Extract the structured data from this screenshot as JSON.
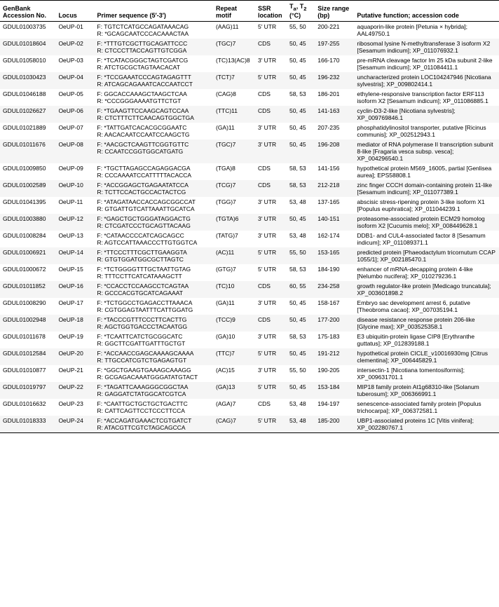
{
  "table": {
    "headers": [
      "GenBank\nAccession No.",
      "Locus",
      "Primer sequence (5′-3′)",
      "Repeat\nmotif",
      "SSR\nlocation",
      "Tₙ, Tₙ\n(°C)",
      "Size range\n(bp)",
      "Putative function; accession code"
    ],
    "rows": [
      {
        "accession": "GDUL01003735",
        "locus": "OeUP-01",
        "primer_f": "F: TGTCTCATGCCAGATAAACAG",
        "primer_r": "R: *GCAGCAATCCCACAAACTAA",
        "repeat": "(AAG)11",
        "ssr_loc": "5′ UTR",
        "temp": "55, 50",
        "size": "200-221",
        "function": "aquaporin-like protein [Petunia × hybrida]; AAL49750.1"
      },
      {
        "accession": "GDUL01018604",
        "locus": "OeUP-02",
        "primer_f": "F: *TTTGTCGCTTGCAGATTCCC",
        "primer_r": "R: CTCCCTTACCAGTTGTCGGA",
        "repeat": "(TGC)7",
        "ssr_loc": "CDS",
        "temp": "50, 45",
        "size": "197-255",
        "function": "ribosomal lysine N-methyltransferase 3 isoform X2 [Sesamum indicum]; XP_011076932.1"
      },
      {
        "accession": "GDUL01058010",
        "locus": "OeUP-03",
        "primer_f": "F: *TCATACGGGCTAGTCGATCG",
        "primer_r": "R: ATCTGCGCTAGTAACACAT",
        "repeat": "(TC)13(AC)8",
        "ssr_loc": "3′ UTR",
        "temp": "50, 45",
        "size": "166-170",
        "function": "pre-mRNA cleavage factor Im 25 kDa subunit 2-like [Sesamum indicum]; XP_011084411.1"
      },
      {
        "accession": "GDUL01030423",
        "locus": "OeUP-04",
        "primer_f": "F: *TCCGAAATCCCAGTAGAGTTT",
        "primer_r": "R: ATCAGCAGAAATCACCAATCCT",
        "repeat": "(TCT)7",
        "ssr_loc": "5′ UTR",
        "temp": "50, 45",
        "size": "196-232",
        "function": "uncharacterized protein LOC104247946 [Nicotiana sylvestris]; XP_009802414.1"
      },
      {
        "accession": "GDUL01046188",
        "locus": "OeUP-05",
        "primer_f": "F: GGCACCAAAGCTAAGCTCAA",
        "primer_r": "R: *CCCGGGAAAATGTTCTGT",
        "repeat": "(CAG)8",
        "ssr_loc": "CDS",
        "temp": "58, 53",
        "size": "186-201",
        "function": "ethylene-responsive transcription factor ERF113 isoform X2 [Sesamum indicum]; XP_011086885.1"
      },
      {
        "accession": "GDUL01026627",
        "locus": "OeUP-06",
        "primer_f": "F: *TGAAGTTCCAAGCAGTCCAA",
        "primer_r": "R: CTCTTTCTTCAACAGTGGCTGA",
        "repeat": "(TTC)11",
        "ssr_loc": "CDS",
        "temp": "50, 45",
        "size": "141-163",
        "function": "cyclin-D3-2-like [Nicotiana sylvestris]; XP_009769846.1"
      },
      {
        "accession": "GDUL01021889",
        "locus": "OeUP-07",
        "primer_f": "F: *TATTGATCACACGCGGAATC",
        "primer_r": "R: AACACAATCCAATCCAAGCTG",
        "repeat": "(GA)11",
        "ssr_loc": "3′ UTR",
        "temp": "50, 45",
        "size": "207-235",
        "function": "phosphatidylinositol transporter, putative [Ricinus communis]; XP_002512943.1"
      },
      {
        "accession": "GDUL01011676",
        "locus": "OeUP-08",
        "primer_f": "F: *AACGCTCAAGTTCGGTGTTC",
        "primer_r": "R: CCAATCCGGTGGCATGATG",
        "repeat": "(TGC)7",
        "ssr_loc": "3′ UTR",
        "temp": "50, 45",
        "size": "196-208",
        "function": "mediator of RNA polymerase II transcription subunit 8-like [Fragaria vesca subsp. vesca]; XP_004296540.1"
      },
      {
        "accession": "GDUL01009850",
        "locus": "OeUP-09",
        "primer_f": "F: *TGCTTAGAGCCAGAGGACGA",
        "primer_r": "R: CCCAAAATCCATTTTTACACCA",
        "repeat": "(TGA)8",
        "ssr_loc": "CDS",
        "temp": "58, 53",
        "size": "141-156",
        "function": "hypothetical protein M569_16005, partial [Genlisea aurea]; EPS58808.1"
      },
      {
        "accession": "GDUL01002589",
        "locus": "OeUP-10",
        "primer_f": "F: *ACCGGAGCTGAGAATATCCA",
        "primer_r": "R: TCTTCCACTGCCACTACTCG",
        "repeat": "(TCG)7",
        "ssr_loc": "CDS",
        "temp": "58, 53",
        "size": "212-218",
        "function": "zinc finger CCCH domain-containing protein 11-like [Sesamum indicum]; XP_011077389.1"
      },
      {
        "accession": "GDUL01041395",
        "locus": "OeUP-11",
        "primer_f": "F: *ATAGATAACCACCAGCGGCCAT",
        "primer_r": "R: GTGATTGTCATTAAATTGCATCA",
        "repeat": "(TGG)7",
        "ssr_loc": "3′ UTR",
        "temp": "53, 48",
        "size": "137-165",
        "function": "abscisic stress-ripening protein 3-like isoform X1 [Populus euphratica]; XP_011044239.1"
      },
      {
        "accession": "GDUL01003880",
        "locus": "OeUP-12",
        "primer_f": "F: *GAGCTGCTGGGATAGGACTG",
        "primer_r": "R: CTCGATCCCTGCAGTTACAAG",
        "repeat": "(TGTA)6",
        "ssr_loc": "3′ UTR",
        "temp": "50, 45",
        "size": "140-151",
        "function": "proteasome-associated protein ECM29 homolog isoform X2 [Cucumis melo]; XP_008449628.1"
      },
      {
        "accession": "GDUL01008284",
        "locus": "OeUP-13",
        "primer_f": "F: *CATAACCCCATCAGCAGCC",
        "primer_r": "R: AGTCCATTAAACCCTTGTGGTCA",
        "repeat": "(TATG)7",
        "ssr_loc": "3′ UTR",
        "temp": "53, 48",
        "size": "162-174",
        "function": "DDB1- and CUL4-associated factor 8 [Sesamum indicum]; XP_011089371.1"
      },
      {
        "accession": "GDUL01006921",
        "locus": "OeUP-14",
        "primer_f": "F: *TTCCCTTTCGCTTGAAGGTA",
        "primer_r": "R: GTGTGGATGGCGCTTAGTC",
        "repeat": "(AC)11",
        "ssr_loc": "5′ UTR",
        "temp": "55, 50",
        "size": "153-165",
        "function": "predicted protein [Phaeodactylum tricornutum CCAP 1055/1]; XP_002185470.1"
      },
      {
        "accession": "GDUL01000672",
        "locus": "OeUP-15",
        "primer_f": "F: *TCTGGGGTTTGCTAATTGTAG",
        "primer_r": "R: TTTCCTTCATCATAAAGCTT",
        "repeat": "(GTG)7",
        "ssr_loc": "5′ UTR",
        "temp": "58, 53",
        "size": "184-190",
        "function": "enhancer of mRNA-decapping protein 4-like [Nelumbo nucifera]; XP_010279236.1"
      },
      {
        "accession": "GDUL01011852",
        "locus": "OeUP-16",
        "primer_f": "F: *CCACCTCCAAGCCTCAGTAA",
        "primer_r": "R: GCCCACGTGCATCAGAAAT",
        "repeat": "(TC)10",
        "ssr_loc": "CDS",
        "temp": "60, 55",
        "size": "234-258",
        "function": "growth regulator-like protein [Medicago truncatula]; XP_003601898.2"
      },
      {
        "accession": "GDUL01008290",
        "locus": "OeUP-17",
        "primer_f": "F: *TCTGGCCTGAGACCTTAAACA",
        "primer_r": "R: CGTGGAGTAATTTCATTGGATG",
        "repeat": "(GA)11",
        "ssr_loc": "3′ UTR",
        "temp": "50, 45",
        "size": "158-167",
        "function": "Embryo sac development arrest 6, putative [Theobroma cacao]; XP_007035194.1"
      },
      {
        "accession": "GDUL01002948",
        "locus": "OeUP-18",
        "primer_f": "F: *TACCCGTTTCCCTTCACTTG",
        "primer_r": "R: AGCTGGTGACCCTACAATGG",
        "repeat": "(TCC)9",
        "ssr_loc": "CDS",
        "temp": "50, 45",
        "size": "177-200",
        "function": "disease resistance response protein 206-like [Glycine max]; XP_003525358.1"
      },
      {
        "accession": "GDUL01011678",
        "locus": "OeUP-19",
        "primer_f": "F: *TCAATTCATCTGCGGCATC",
        "primer_r": "R: GGCTTCGATTGATTTGCTGT",
        "repeat": "(GA)10",
        "ssr_loc": "3′ UTR",
        "temp": "58, 53",
        "size": "175-183",
        "function": "E3 ubiquitin-protein ligase CIP8 [Erythranthe guttatus]; XP_012839188.1"
      },
      {
        "accession": "GDUL01012584",
        "locus": "OeUP-20",
        "primer_f": "F: *ACCAACCGAGCAAAAGCAAAA",
        "primer_r": "R: TTGCCATCGTCTGAGAGTGT",
        "repeat": "(TTC)7",
        "ssr_loc": "5′ UTR",
        "temp": "50, 45",
        "size": "191-212",
        "function": "hypothetical protein CICLE_v10016930mg [Citrus clementina]; XP_006445829.1"
      },
      {
        "accession": "GDUL01010877",
        "locus": "OeUP-21",
        "primer_f": "F: *GGCTGAAGTGAAAGCAAAGG",
        "primer_r": "R: GCGAGACAAATGGGATATGTACT",
        "repeat": "(AC)15",
        "ssr_loc": "3′ UTR",
        "temp": "55, 50",
        "size": "190-205",
        "function": "intersectin-1 [Nicotiana tomentosiformis]; XP_009631701.1"
      },
      {
        "accession": "GDUL01019797",
        "locus": "OeUP-22",
        "primer_f": "F: *TAGATTCAAAGGGCGGCTAA",
        "primer_r": "R: GAGGATCTATGGCATCGTCA",
        "repeat": "(GA)13",
        "ssr_loc": "5′ UTR",
        "temp": "50, 45",
        "size": "153-184",
        "function": "MIP18 family protein At1g68310-like [Solanum tuberosum]; XP_006366991.1"
      },
      {
        "accession": "GDUL01016632",
        "locus": "OeUP-23",
        "primer_f": "F: *CAATTGCTGCTGCTGACTTC",
        "primer_r": "R: CATTCAGTTCCTCCCTTCCA",
        "repeat": "(AGA)7",
        "ssr_loc": "CDS",
        "temp": "53, 48",
        "size": "194-197",
        "function": "senescence-associated family protein [Populus trichocarpa]; XP_006372581.1"
      },
      {
        "accession": "GDUL01018333",
        "locus": "OeUP-24",
        "primer_f": "F: *ACCAGATGAAACTCGTGATCT",
        "primer_r": "R: ATACGTTCGTCTAGCAGCCA",
        "repeat": "(CAG)7",
        "ssr_loc": "5′ UTR",
        "temp": "53, 48",
        "size": "185-200",
        "function": "UBP1-associated proteins 1C [Vitis vinifera]; XP_002280767.1"
      }
    ]
  }
}
